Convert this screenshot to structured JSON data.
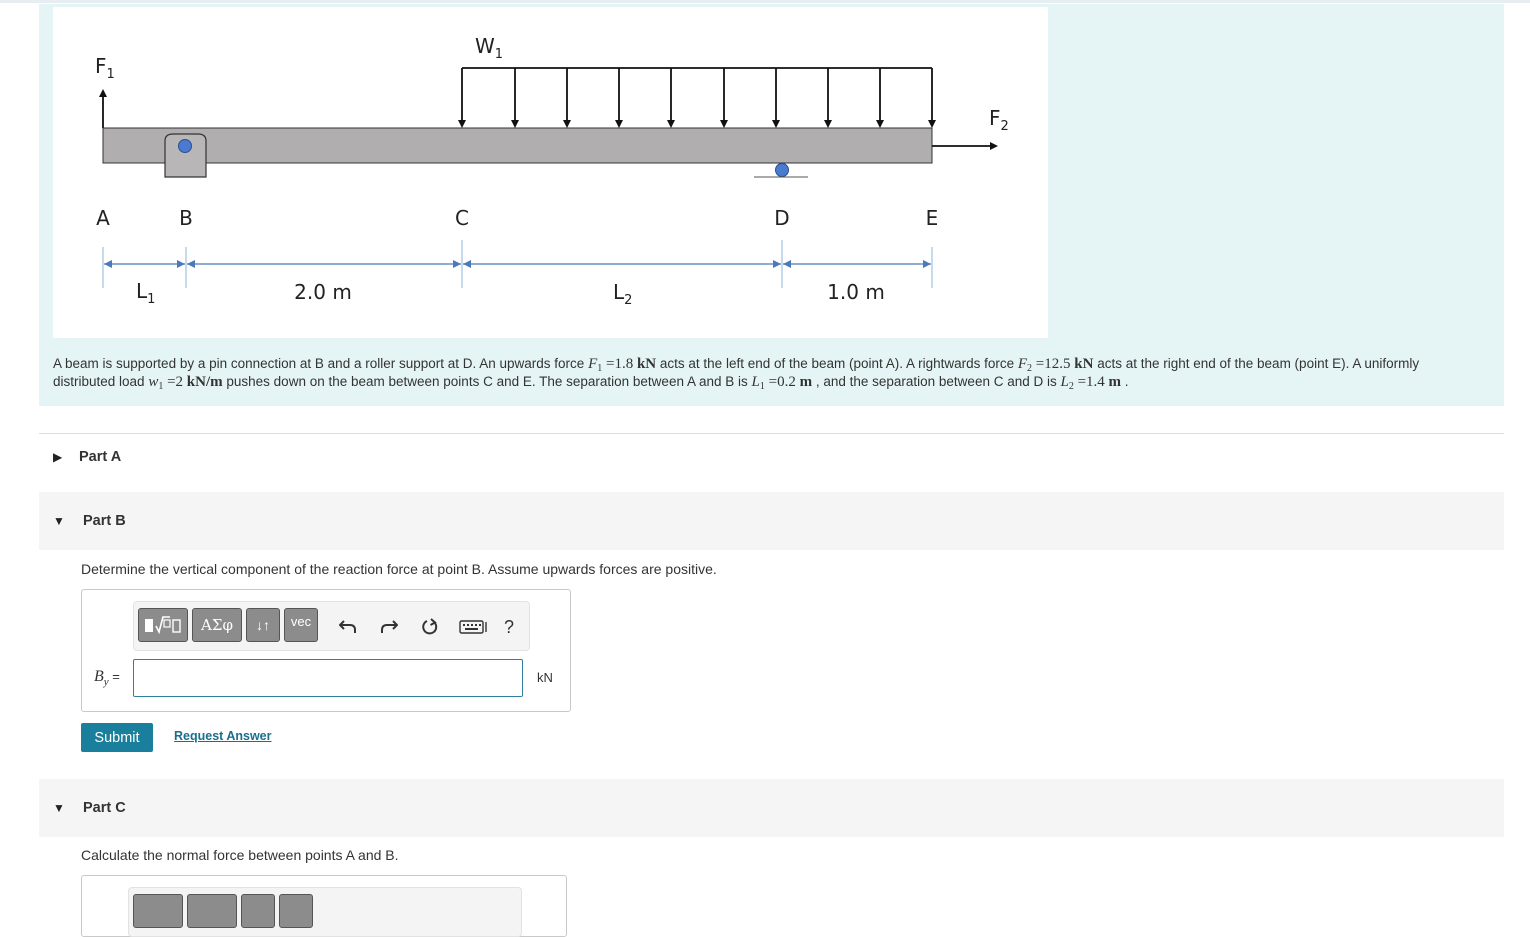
{
  "figure": {
    "labels": {
      "F1": "F",
      "F1_sub": "1",
      "W1": "W",
      "W1_sub": "1",
      "F2": "F",
      "F2_sub": "2",
      "A": "A",
      "B": "B",
      "C": "C",
      "D": "D",
      "E": "E",
      "L1": "L",
      "L1_sub": "1",
      "dim_BC": "2.0 m",
      "L2": "L",
      "L2_sub": "2",
      "dim_DE": "1.0 m"
    },
    "colors": {
      "beam": "#b0aeae",
      "support_pin": "#4a7bd0",
      "dimension_line": "#4a7ab8"
    }
  },
  "problem": {
    "t1": "A beam is supported by a pin connection at B and a roller support at D. An upwards force ",
    "F1_sym": "F",
    "F1_sub": "1",
    "F1_val": " =1.8 ",
    "F1_unit": "kN",
    "t2": " acts at the left end of the beam (point A). A rightwards force ",
    "F2_sym": "F",
    "F2_sub": "2",
    "F2_val": " =12.5 ",
    "F2_unit": "kN",
    "t3": " acts at the right end of the beam (point E). A uniformly distributed load ",
    "w1_sym": "w",
    "w1_sub": "1",
    "w1_val": " =2 ",
    "w1_unit": "kN/m",
    "t4": " pushes down on the beam between points C and E. The separation between A and B is ",
    "L1_sym": "L",
    "L1_sub": "1",
    "L1_val": " =0.2 ",
    "L1_unit": "m",
    "t5": " , and the separation between C and D is ",
    "L2_sym": "L",
    "L2_sub": "2",
    "L2_val": " =1.4 ",
    "L2_unit": "m",
    "t6": " ."
  },
  "parts": {
    "a": {
      "label": "Part A"
    },
    "b": {
      "label": "Part B",
      "question": "Determine the vertical component of the reaction force at point B. Assume upwards forces are positive.",
      "var": "B",
      "var_sub": "y",
      "equals": " =",
      "input_value": "",
      "unit": "kN",
      "submit_label": "Submit",
      "request_label": "Request Answer"
    },
    "c": {
      "label": "Part C",
      "question": "Calculate the normal force between points A and B."
    }
  },
  "toolbar": {
    "greek_label": "ΑΣφ",
    "arrows_label": "↓↑",
    "vec_label": "vec",
    "help_label": "?"
  }
}
